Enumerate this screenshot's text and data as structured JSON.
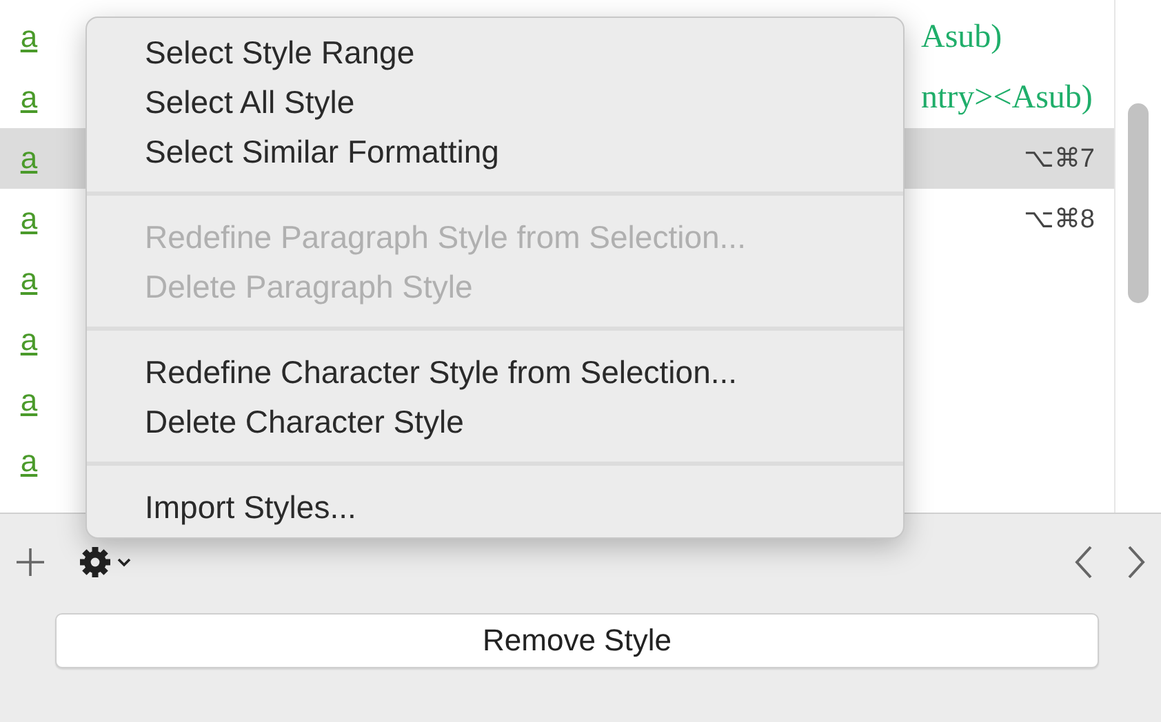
{
  "style_list": {
    "rows": [
      {
        "icon": "a",
        "trailing": "Asub)",
        "shortcut": "",
        "selected": false
      },
      {
        "icon": "a",
        "trailing": "ntry><Asub)",
        "shortcut": "",
        "selected": false
      },
      {
        "icon": "a",
        "trailing": "",
        "shortcut": "⌥⌘7",
        "selected": true
      },
      {
        "icon": "a",
        "trailing": "",
        "shortcut": "⌥⌘8",
        "selected": false
      },
      {
        "icon": "a",
        "trailing": "",
        "shortcut": "",
        "selected": false
      },
      {
        "icon": "a",
        "trailing": "",
        "shortcut": "",
        "selected": false
      },
      {
        "icon": "a",
        "trailing": "",
        "shortcut": "",
        "selected": false
      },
      {
        "icon": "a",
        "trailing": "",
        "shortcut": "",
        "selected": false
      }
    ]
  },
  "context_menu": {
    "groups": [
      [
        {
          "label": "Select Style Range",
          "disabled": false
        },
        {
          "label": "Select All Style",
          "disabled": false
        },
        {
          "label": "Select Similar Formatting",
          "disabled": false
        }
      ],
      [
        {
          "label": "Redefine Paragraph Style from Selection...",
          "disabled": true
        },
        {
          "label": "Delete Paragraph Style",
          "disabled": true
        }
      ],
      [
        {
          "label": "Redefine Character Style from Selection...",
          "disabled": false
        },
        {
          "label": "Delete Character Style",
          "disabled": false
        }
      ],
      [
        {
          "label": "Import Styles...",
          "disabled": false
        }
      ]
    ]
  },
  "footer": {
    "remove_button": "Remove Style"
  }
}
